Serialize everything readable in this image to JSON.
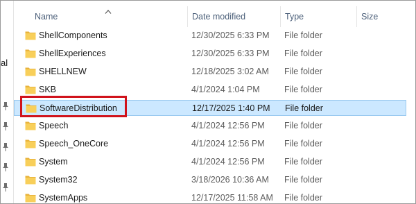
{
  "columns": {
    "name": "Name",
    "date_modified": "Date modified",
    "type": "Type",
    "size": "Size"
  },
  "sort": {
    "column": "name",
    "direction": "ascending"
  },
  "nav_fragment": "al",
  "rows": [
    {
      "name": "ShellComponents",
      "date": "12/30/2025 6:33 PM",
      "type": "File folder",
      "selected": false
    },
    {
      "name": "ShellExperiences",
      "date": "12/30/2025 6:33 PM",
      "type": "File folder",
      "selected": false
    },
    {
      "name": "SHELLNEW",
      "date": "12/18/2025 3:02 AM",
      "type": "File folder",
      "selected": false
    },
    {
      "name": "SKB",
      "date": "4/1/2024 1:04 PM",
      "type": "File folder",
      "selected": false
    },
    {
      "name": "SoftwareDistribution",
      "date": "12/17/2025 1:40 PM",
      "type": "File folder",
      "selected": true
    },
    {
      "name": "Speech",
      "date": "4/1/2024 12:56 PM",
      "type": "File folder",
      "selected": false
    },
    {
      "name": "Speech_OneCore",
      "date": "4/1/2024 12:56 PM",
      "type": "File folder",
      "selected": false
    },
    {
      "name": "System",
      "date": "4/1/2024 12:56 PM",
      "type": "File folder",
      "selected": false
    },
    {
      "name": "System32",
      "date": "3/18/2026 10:36 AM",
      "type": "File folder",
      "selected": false
    },
    {
      "name": "SystemApps",
      "date": "12/17/2025 11:58 AM",
      "type": "File folder",
      "selected": false
    }
  ],
  "colors": {
    "selection_fill": "#cce8ff",
    "selection_border": "#99c9ef",
    "highlight": "#d0121b",
    "folder": "#f5c84c"
  },
  "icons": {
    "folder": "folder-icon",
    "pin": "pin-icon",
    "sort": "sort-ascending-icon"
  }
}
